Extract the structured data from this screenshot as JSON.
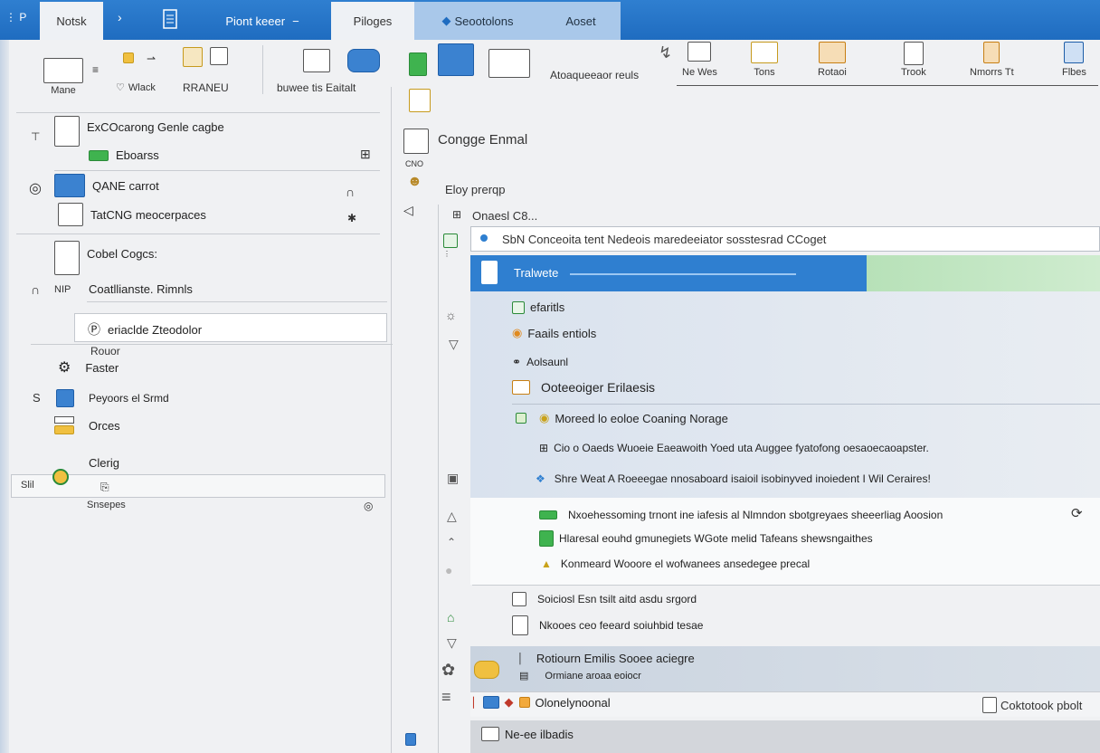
{
  "topbar": {
    "left_glyphs": "⋮ P",
    "tab_home": "Notsk",
    "chevron": "›",
    "tab_active": "Piont keeer",
    "tab_programs": "Piloges",
    "tab_settings": "Seootolons",
    "tab_assets": "Aoset"
  },
  "ribbon": {
    "item1_label": "Mane",
    "item2_label": "Wlack",
    "item3_label": "RRANEU",
    "item4_label": "buwee tis Eaitalt",
    "item5_label": "Atoaqueeaor reuls",
    "right_items": [
      "Ne Wes",
      "Tons",
      "Rotaoi",
      "Trook",
      "Nmorrs Tt",
      "Flbes"
    ]
  },
  "nav": {
    "row1_label": "ExCOcarong Genle cagbe",
    "row1_sub": "Eboarss",
    "row2_label": "QANE carrot",
    "row3_label": "TatCNG meocerpaces",
    "row4_label": "Cobel Cogcs:",
    "row5_prefix": "NIP",
    "row5_label": "Coatllianste. Rimnls",
    "selected_label": "eriaclde Zteodolor",
    "group_header": "Rouor",
    "items": [
      "Faster",
      "Peyoors el Srmd",
      "Orces",
      "Clerig"
    ],
    "bottom_left": "Slil",
    "bottom_label": "Snsepes"
  },
  "content": {
    "heading": "Congge Enmal",
    "heading_sub": "CNO",
    "section": "Eloy prerqp",
    "subsection": "Onaesl C8...",
    "search_value": "SbN Conceoita tent Nedeois maredeeiator sosstesrad CCoget",
    "selected_label": "Tralwete",
    "rows": [
      "efaritls",
      "Faails entiols",
      "Aolsaunl",
      "Ooteeoiger Erilaesis",
      "Moreed lo eoloe Coaning Norage",
      "Cio o Oaeds Wuoeie Eaeawoith Yoed uta Auggee fyatofong oesaoecaoapster.",
      "Shre Weat A Roeeegae nnosaboard isaioil isobinyved inoiedent I Wil Ceraires!",
      "Nxoehessoming trnont ine iafesis al Nlmndon sbotgreyaes sheeerliag Aoosion",
      "Hlaresal eouhd gmunegiets WGote melid Tafeans shewsngaithes",
      "Konmeard Wooore el wofwanees ansedegee precal",
      "Soiciosl Esn tsilt aitd asdu srgord",
      "Nkooes ceo feeard soiuhbid tesae",
      "Rotiourn Emilis Sooee aciegre",
      "Ormiane aroaa eoiocr",
      "Olonelynoonal",
      "Ne-ee ilbadis"
    ],
    "right_button": "Coktotook pbolt"
  },
  "colors": {
    "accent": "#2f7fd0",
    "progress": "#b7e1b8"
  }
}
